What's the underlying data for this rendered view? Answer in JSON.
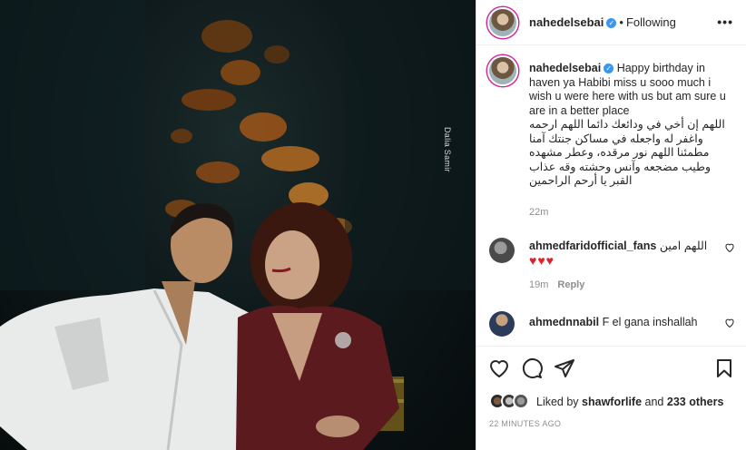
{
  "photo": {
    "watermark": "Dalia Samir"
  },
  "header": {
    "username": "nahedelsebai",
    "verified_mark": "✓",
    "separator": "•",
    "follow_status": "Following",
    "more_icon": "•••"
  },
  "caption": {
    "username": "nahedelsebai",
    "text_en": "Happy birthday in haven ya Habibi miss u sooo much i wish u were here with us but am sure u are in a better place",
    "text_ar": "اللهم إن أخي في ودائعك دائما اللهم ارحمه واغفر له واجعله في مساكن جنتك آمنا مطمئنا اللهم نور مرقده، وعطر مشهده وطيب مضجعه وآنس وحشته وقه عذاب القبر يا أرحم الراحمين",
    "time": "22m"
  },
  "comments": [
    {
      "username": "ahmedfaridofficial_fans",
      "text": "اللهم امين",
      "hearts": "♥♥♥",
      "time": "19m",
      "reply_label": "Reply"
    },
    {
      "username": "ahmednnabil",
      "text": "F el gana inshallah"
    }
  ],
  "actions": {
    "icons": [
      "heart-icon",
      "comment-icon",
      "share-icon",
      "bookmark-icon"
    ]
  },
  "likes": {
    "prefix": "Liked by",
    "user": "shawforlife",
    "connector": "and",
    "others": "233 others"
  },
  "post_time": "22 MINUTES AGO",
  "colors": {
    "verified": "#3897f0",
    "hearts": "#e0212c",
    "secondary_text": "#8e8e8e"
  }
}
